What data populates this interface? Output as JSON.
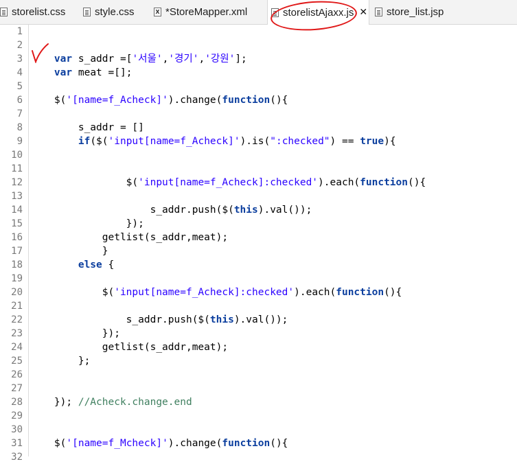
{
  "tabs": [
    {
      "label": "storelist.css",
      "icon": "css-file-icon"
    },
    {
      "label": "style.css",
      "icon": "css-file-icon"
    },
    {
      "label": "*StoreMapper.xml",
      "icon": "xml-file-icon",
      "icon_glyph": "X"
    },
    {
      "label": "storelistAjaxx.js",
      "icon": "js-file-icon",
      "active": true,
      "close": "✕"
    },
    {
      "label": "store_list.jsp",
      "icon": "jsp-file-icon"
    }
  ],
  "colors": {
    "keyword": "#0b3e9e",
    "string": "#2a00ff",
    "comment": "#3f7f5f",
    "annotation_red": "#e01818"
  },
  "lines": [
    {
      "n": "1",
      "t": ""
    },
    {
      "n": "2",
      "t": ""
    },
    {
      "n": "3",
      "t": "    <span class=\"kw\">var</span> s_addr =[<span class=\"st\">'서울'</span>,<span class=\"st\">'경기'</span>,<span class=\"st\">'강원'</span>];"
    },
    {
      "n": "4",
      "t": "    <span class=\"kw\">var</span> meat =[];"
    },
    {
      "n": "5",
      "t": ""
    },
    {
      "n": "6",
      "t": "    $(<span class=\"st\">'[name=f_Acheck]'</span>).change(<span class=\"kw\">function</span>(){"
    },
    {
      "n": "7",
      "t": ""
    },
    {
      "n": "8",
      "t": "        s_addr = []"
    },
    {
      "n": "9",
      "t": "        <span class=\"kw\">if</span>($(<span class=\"st\">'input[name=f_Acheck]'</span>).is(<span class=\"st\">\":checked\"</span>) == <span class=\"kw\">true</span>){"
    },
    {
      "n": "10",
      "t": ""
    },
    {
      "n": "11",
      "t": ""
    },
    {
      "n": "12",
      "t": "                $(<span class=\"st\">'input[name=f_Acheck]:checked'</span>).each(<span class=\"kw\">function</span>(){"
    },
    {
      "n": "13",
      "t": ""
    },
    {
      "n": "14",
      "t": "                    s_addr.push($(<span class=\"kw\">this</span>).val());"
    },
    {
      "n": "15",
      "t": "                });"
    },
    {
      "n": "16",
      "t": "            getlist(s_addr,meat);"
    },
    {
      "n": "17",
      "t": "            }"
    },
    {
      "n": "18",
      "t": "        <span class=\"kw\">else</span> {"
    },
    {
      "n": "19",
      "t": ""
    },
    {
      "n": "20",
      "t": "            $(<span class=\"st\">'input[name=f_Acheck]:checked'</span>).each(<span class=\"kw\">function</span>(){"
    },
    {
      "n": "21",
      "t": ""
    },
    {
      "n": "22",
      "t": "                s_addr.push($(<span class=\"kw\">this</span>).val());"
    },
    {
      "n": "23",
      "t": "            });"
    },
    {
      "n": "24",
      "t": "            getlist(s_addr,meat);"
    },
    {
      "n": "25",
      "t": "        };"
    },
    {
      "n": "26",
      "t": ""
    },
    {
      "n": "27",
      "t": ""
    },
    {
      "n": "28",
      "t": "    }); <span class=\"cm\">//Acheck.change.end</span>"
    },
    {
      "n": "29",
      "t": ""
    },
    {
      "n": "30",
      "t": ""
    },
    {
      "n": "31",
      "t": "    $(<span class=\"st\">'[name=f_Mcheck]'</span>).change(<span class=\"kw\">function</span>(){"
    },
    {
      "n": "32",
      "t": ""
    }
  ]
}
